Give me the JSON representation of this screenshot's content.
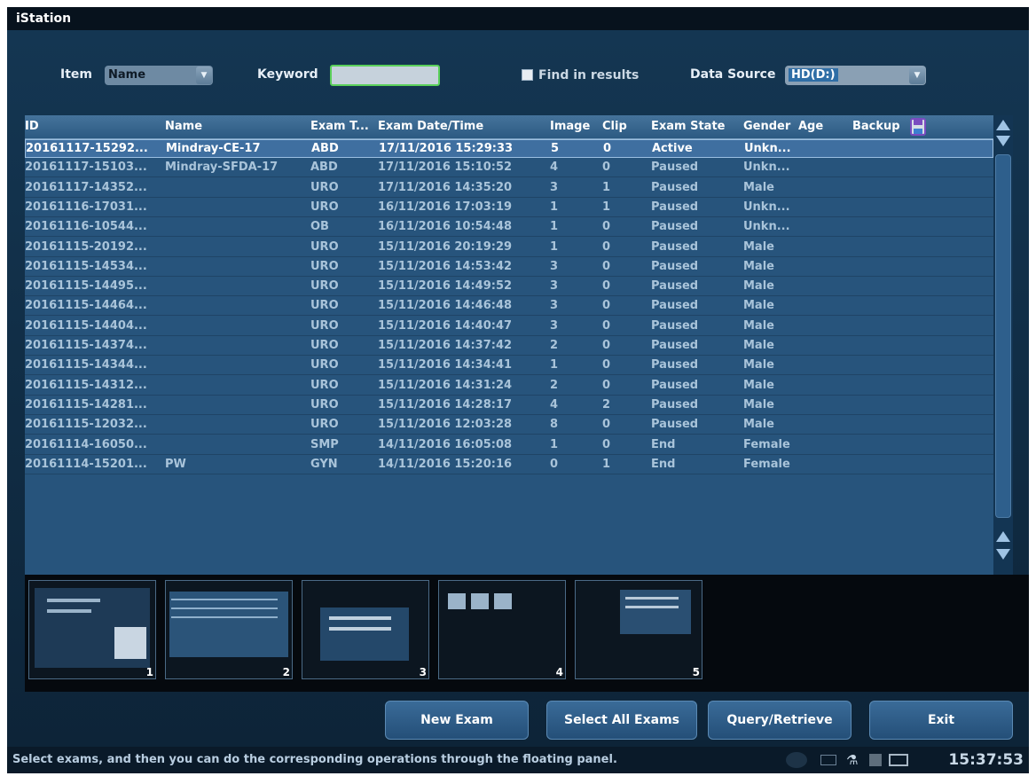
{
  "window": {
    "title": "iStation"
  },
  "filter": {
    "item_label": "Item",
    "item_value": "Name",
    "keyword_label": "Keyword",
    "keyword_value": "",
    "find_in_results_label": "Find in results",
    "find_in_results_checked": false,
    "data_source_label": "Data Source",
    "data_source_value": "HD(D:)"
  },
  "table": {
    "columns": [
      "ID",
      "Name",
      "Exam T...",
      "Exam Date/Time",
      "Image",
      "Clip",
      "Exam State",
      "Gender",
      "Age",
      "Backup"
    ],
    "rows": [
      {
        "id": "20161117-15292...",
        "name": "Mindray-CE-17",
        "exam": "ABD",
        "date": "17/11/2016 15:29:33",
        "image": "5",
        "clip": "0",
        "state": "Active",
        "gender": "Unkn...",
        "age": "",
        "backup": ""
      },
      {
        "id": "20161117-15103...",
        "name": "Mindray-SFDA-17",
        "exam": "ABD",
        "date": "17/11/2016 15:10:52",
        "image": "4",
        "clip": "0",
        "state": "Paused",
        "gender": "Unkn...",
        "age": "",
        "backup": ""
      },
      {
        "id": "20161117-14352...",
        "name": "",
        "exam": "URO",
        "date": "17/11/2016 14:35:20",
        "image": "3",
        "clip": "1",
        "state": "Paused",
        "gender": "Male",
        "age": "",
        "backup": ""
      },
      {
        "id": "20161116-17031...",
        "name": "",
        "exam": "URO",
        "date": "16/11/2016 17:03:19",
        "image": "1",
        "clip": "1",
        "state": "Paused",
        "gender": "Unkn...",
        "age": "",
        "backup": ""
      },
      {
        "id": "20161116-10544...",
        "name": "",
        "exam": "OB",
        "date": "16/11/2016 10:54:48",
        "image": "1",
        "clip": "0",
        "state": "Paused",
        "gender": "Unkn...",
        "age": "",
        "backup": ""
      },
      {
        "id": "20161115-20192...",
        "name": "",
        "exam": "URO",
        "date": "15/11/2016 20:19:29",
        "image": "1",
        "clip": "0",
        "state": "Paused",
        "gender": "Male",
        "age": "",
        "backup": ""
      },
      {
        "id": "20161115-14534...",
        "name": "",
        "exam": "URO",
        "date": "15/11/2016 14:53:42",
        "image": "3",
        "clip": "0",
        "state": "Paused",
        "gender": "Male",
        "age": "",
        "backup": ""
      },
      {
        "id": "20161115-14495...",
        "name": "",
        "exam": "URO",
        "date": "15/11/2016 14:49:52",
        "image": "3",
        "clip": "0",
        "state": "Paused",
        "gender": "Male",
        "age": "",
        "backup": ""
      },
      {
        "id": "20161115-14464...",
        "name": "",
        "exam": "URO",
        "date": "15/11/2016 14:46:48",
        "image": "3",
        "clip": "0",
        "state": "Paused",
        "gender": "Male",
        "age": "",
        "backup": ""
      },
      {
        "id": "20161115-14404...",
        "name": "",
        "exam": "URO",
        "date": "15/11/2016 14:40:47",
        "image": "3",
        "clip": "0",
        "state": "Paused",
        "gender": "Male",
        "age": "",
        "backup": ""
      },
      {
        "id": "20161115-14374...",
        "name": "",
        "exam": "URO",
        "date": "15/11/2016 14:37:42",
        "image": "2",
        "clip": "0",
        "state": "Paused",
        "gender": "Male",
        "age": "",
        "backup": ""
      },
      {
        "id": "20161115-14344...",
        "name": "",
        "exam": "URO",
        "date": "15/11/2016 14:34:41",
        "image": "1",
        "clip": "0",
        "state": "Paused",
        "gender": "Male",
        "age": "",
        "backup": ""
      },
      {
        "id": "20161115-14312...",
        "name": "",
        "exam": "URO",
        "date": "15/11/2016 14:31:24",
        "image": "2",
        "clip": "0",
        "state": "Paused",
        "gender": "Male",
        "age": "",
        "backup": ""
      },
      {
        "id": "20161115-14281...",
        "name": "",
        "exam": "URO",
        "date": "15/11/2016 14:28:17",
        "image": "4",
        "clip": "2",
        "state": "Paused",
        "gender": "Male",
        "age": "",
        "backup": ""
      },
      {
        "id": "20161115-12032...",
        "name": "",
        "exam": "URO",
        "date": "15/11/2016 12:03:28",
        "image": "8",
        "clip": "0",
        "state": "Paused",
        "gender": "Male",
        "age": "",
        "backup": ""
      },
      {
        "id": "20161114-16050...",
        "name": "",
        "exam": "SMP",
        "date": "14/11/2016 16:05:08",
        "image": "1",
        "clip": "0",
        "state": "End",
        "gender": "Female",
        "age": "",
        "backup": ""
      },
      {
        "id": "20161114-15201...",
        "name": "PW",
        "exam": "GYN",
        "date": "14/11/2016 15:20:16",
        "image": "0",
        "clip": "1",
        "state": "End",
        "gender": "Female",
        "age": "",
        "backup": ""
      }
    ]
  },
  "thumbnails": [
    "1",
    "2",
    "3",
    "4",
    "5"
  ],
  "buttons": {
    "new_exam": "New Exam",
    "select_all": "Select All Exams",
    "query_retrieve": "Query/Retrieve",
    "exit": "Exit"
  },
  "status": {
    "message": "Select exams, and then you can do the corresponding operations through the floating panel.",
    "time": "15:37:53"
  },
  "icons": [
    "backup-disk-icon",
    "scroll-up-icon",
    "scroll-down-icon",
    "status-monitor-icon",
    "usb-icon",
    "printer-icon",
    "network-icon"
  ],
  "colors": {
    "background": "#0f2336",
    "grid": "#27547c",
    "selected_row": "#3f6fa0",
    "keyword_border": "#5ad05a"
  }
}
